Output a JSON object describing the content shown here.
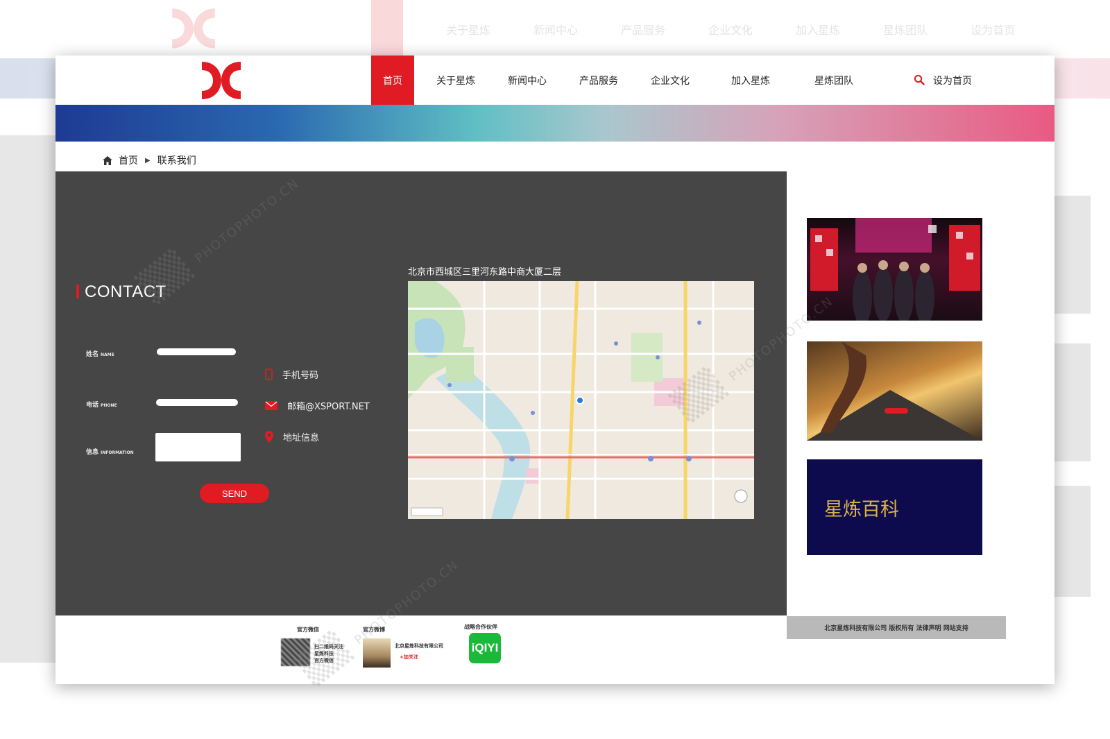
{
  "nav": {
    "items": [
      "首页",
      "关于星炼",
      "新闻中心",
      "产品服务",
      "企业文化",
      "加入星炼",
      "星炼团队"
    ],
    "active": "首页",
    "set_home": "设为首页"
  },
  "breadcrumb": {
    "home": "首页",
    "current": "联系我们"
  },
  "contact": {
    "title": "CONTACT",
    "name_label": "姓名",
    "name_label_en": "NAME",
    "phone_label": "电话",
    "phone_label_en": "PHONE",
    "info_label": "信息",
    "info_label_en": "INFORMATION",
    "send": "SEND"
  },
  "contact_info": {
    "phone": "手机号码",
    "email": "邮箱@XSPORT.NET",
    "address": "地址信息"
  },
  "map": {
    "address": "北京市西城区三里河东路中商大厦二层"
  },
  "sidebar": {
    "wiki": "星炼百科"
  },
  "footer": {
    "wechat_title": "官方微信",
    "wechat_text": [
      "扫二维码关注",
      "星炼科技",
      "官方微信"
    ],
    "weibo_title": "官方微博",
    "weibo_name": "北京星炼科技有限公司",
    "weibo_follow": "+加关注",
    "partner_title": "战略合作伙伴",
    "partner_logo": "iQIYI",
    "copyright": "北京星炼科技有限公司  版权所有  法律声明  网站支持"
  },
  "colors": {
    "accent": "#e11b24",
    "content_bg": "#464646",
    "wiki_bg": "#0d0b4e",
    "wiki_text": "#d8b347"
  }
}
